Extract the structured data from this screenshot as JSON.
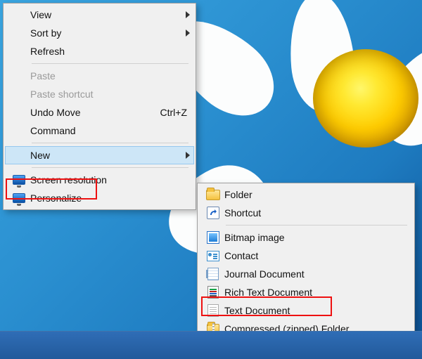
{
  "desktop_menu": {
    "items": [
      {
        "label": "View",
        "has_submenu": true
      },
      {
        "label": "Sort by",
        "has_submenu": true
      },
      {
        "label": "Refresh"
      }
    ],
    "clipboard": [
      {
        "label": "Paste",
        "disabled": true
      },
      {
        "label": "Paste shortcut",
        "disabled": true
      },
      {
        "label": "Undo Move",
        "shortcut": "Ctrl+Z"
      },
      {
        "label": "Command"
      }
    ],
    "new_label": "New",
    "settings": [
      {
        "label": "Screen resolution"
      },
      {
        "label": "Personalize"
      }
    ]
  },
  "new_submenu": {
    "items": [
      {
        "label": "Folder",
        "icon": "folder-icon"
      },
      {
        "label": "Shortcut",
        "icon": "shortcut-icon"
      },
      {
        "label": "Bitmap image",
        "icon": "bitmap-icon"
      },
      {
        "label": "Contact",
        "icon": "contact-icon"
      },
      {
        "label": "Journal Document",
        "icon": "journal-icon"
      },
      {
        "label": "Rich Text Document",
        "icon": "rtf-icon"
      },
      {
        "label": "Text Document",
        "icon": "txt-icon"
      },
      {
        "label": "Compressed (zipped) Folder",
        "icon": "zip-icon"
      }
    ]
  }
}
